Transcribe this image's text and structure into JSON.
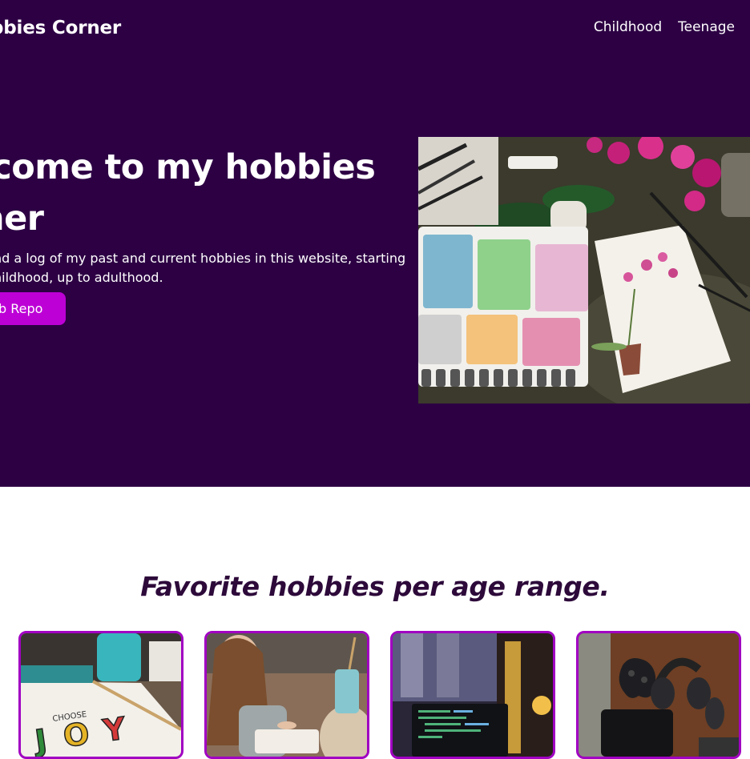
{
  "header": {
    "brand": "bbies Corner",
    "nav": [
      "Childhood",
      "Teenage"
    ]
  },
  "hero": {
    "title": "lcome to my hobbies\nner",
    "description": "nd a log of my past and current hobbies in this website, starting\nhildhood, up to adulthood.",
    "button_label": "b Repo",
    "image_icon": "watercolor-palette-image"
  },
  "section": {
    "title": "Favorite hobbies per age range."
  },
  "cards": [
    {
      "icon": "choose-joy-drawing-image"
    },
    {
      "icon": "reading-girl-image"
    },
    {
      "icon": "laptop-code-image"
    },
    {
      "icon": "gaming-gear-image"
    }
  ],
  "colors": {
    "hero_bg": "#2d0044",
    "accent": "#bd00d6",
    "card_border": "#a100c2",
    "section_title": "#2d0a3a"
  }
}
